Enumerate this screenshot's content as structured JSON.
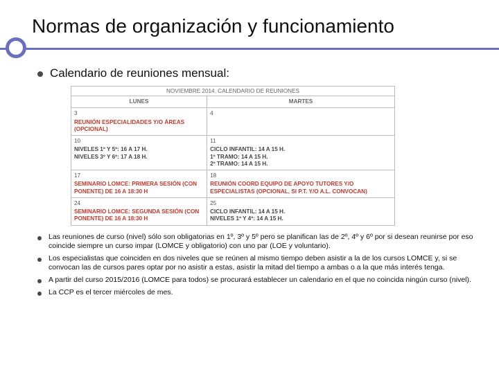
{
  "title": "Normas de organización y funcionamiento",
  "lead": "Calendario de reuniones mensual:",
  "table": {
    "caption": "NOVIEMBRE 2014. CALENDARIO DE REUNIONES",
    "heads": [
      "LUNES",
      "MARTES"
    ],
    "rows": [
      {
        "left_day": "3",
        "left_html": "REUNIÓN ESPECIALIDADES Y/O ÁREAS (OPCIONAL)",
        "left_red": true,
        "right_day": "4",
        "right_html": "",
        "right_red": false
      },
      {
        "left_day": "10",
        "left_html": "NIVELES 1º Y 5º: 16 A 17 H.\nNIVELES 3º Y 6º: 17 A 18 H.",
        "left_red": false,
        "right_day": "11",
        "right_html": "CICLO INFANTIL: 14 A 15 H.\n1º TRAMO: 14 A 15 H.\n2º TRAMO: 14 A 15 H.",
        "right_red": false
      },
      {
        "left_day": "17",
        "left_html": "SEMINARIO LOMCE: PRIMERA SESIÓN (CON PONENTE) DE 16 A 18:30 H",
        "left_red": true,
        "right_day": "18",
        "right_html": "REUNIÓN COORD EQUIPO DE APOYO TUTORES Y/O ESPECIALISTAS (OPCIONAL, SI P.T. Y/O A.L. CONVOCAN)",
        "right_red": true
      },
      {
        "left_day": "24",
        "left_html": "SEMINARIO LOMCE: SEGUNDA SESIÓN (CON PONENTE) DE 16 A 18:30 H",
        "left_red": true,
        "right_day": "25",
        "right_html": "CICLO INFANTIL: 14 A 15 H.\nNIVELES 1º Y 4º: 14 A 15 H.",
        "right_red": false
      }
    ]
  },
  "notes": [
    "Las reuniones de curso (nivel) sólo son obligatorias en 1º, 3º y 5º pero se planifican las de 2º, 4º y 6º por si desean reunirse por eso coincide siempre un curso impar (LOMCE y obligatorio) con uno par (LOE y voluntario).",
    "Los especialistas que coinciden en dos niveles que se reúnen al mismo tiempo deben asistir a la de los cursos LOMCE y, si se convocan las de cursos pares optar por no asistir a estas, asistir la mitad del tiempo a ambas o a la que más interés tenga.",
    "A partir del curso 2015/2016 (LOMCE para todos) se procurará establecer un calendario en el que no coincida ningún curso (nivel).",
    "La CCP es el tercer miércoles de mes."
  ]
}
